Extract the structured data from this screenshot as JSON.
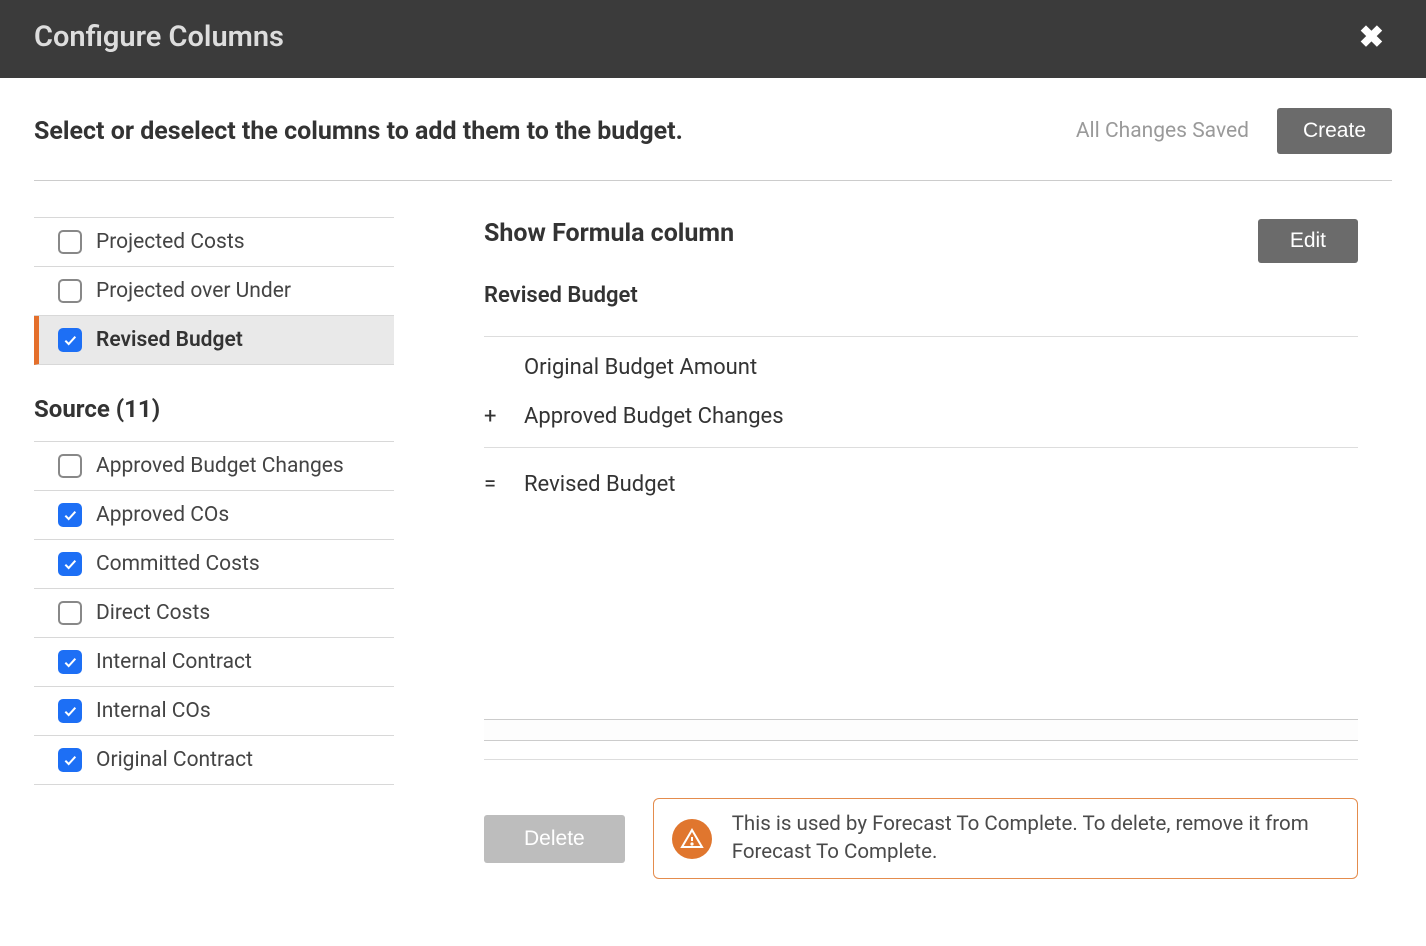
{
  "header": {
    "title": "Configure Columns"
  },
  "subheader": {
    "instruction": "Select or deselect the columns to add them to the budget.",
    "status": "All Changes Saved",
    "create_label": "Create"
  },
  "sidebar": {
    "top_items": [
      {
        "label": "Projected Costs",
        "checked": false
      },
      {
        "label": "Projected over Under",
        "checked": false
      },
      {
        "label": "Revised Budget",
        "checked": true,
        "selected": true
      }
    ],
    "source_section": {
      "title": "Source (11)",
      "items": [
        {
          "label": "Approved Budget Changes",
          "checked": false
        },
        {
          "label": "Approved COs",
          "checked": true
        },
        {
          "label": "Committed Costs",
          "checked": true
        },
        {
          "label": "Direct Costs",
          "checked": false
        },
        {
          "label": "Internal Contract",
          "checked": true
        },
        {
          "label": "Internal COs",
          "checked": true
        },
        {
          "label": "Original Contract",
          "checked": true
        }
      ]
    }
  },
  "detail": {
    "title": "Show Formula column",
    "edit_label": "Edit",
    "name": "Revised Budget",
    "formula": {
      "rows": [
        {
          "op": "",
          "term": "Original Budget Amount"
        },
        {
          "op": "+",
          "term": "Approved Budget Changes"
        }
      ],
      "result_op": "=",
      "result": "Revised Budget"
    },
    "delete_label": "Delete",
    "warning": "This is used by Forecast To Complete. To delete, remove it from Forecast To Complete."
  }
}
